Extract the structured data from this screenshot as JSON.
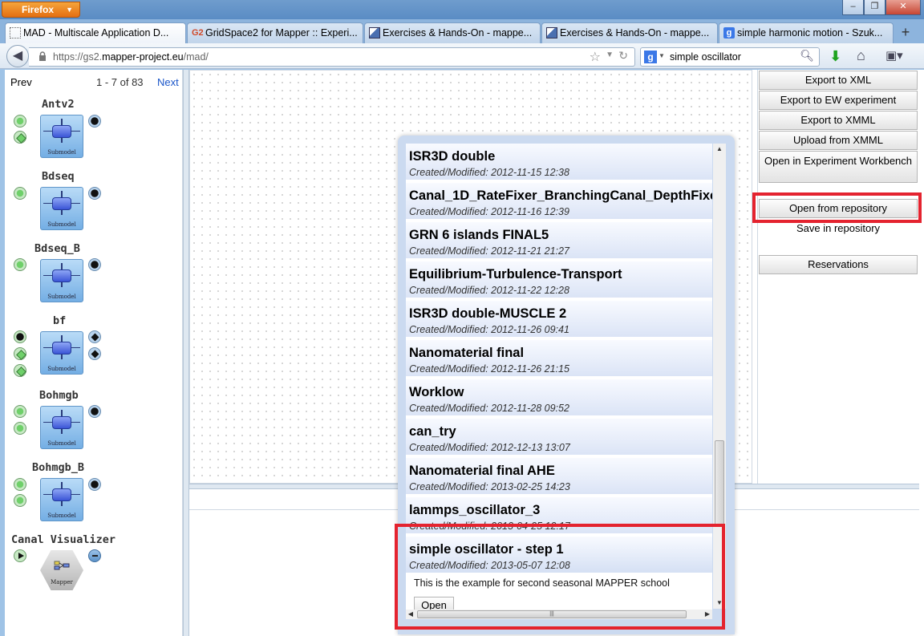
{
  "browser": {
    "menu_label": "Firefox",
    "tabs": [
      {
        "label": "MAD - Multiscale Application D...",
        "icon": "blank-page-icon",
        "active": true
      },
      {
        "label": "GridSpace2 for Mapper :: Experi...",
        "icon": "gridspace-icon",
        "active": false
      },
      {
        "label": "Exercises & Hands-On - mappe...",
        "icon": "page-icon",
        "active": false
      },
      {
        "label": "Exercises & Hands-On - mappe...",
        "icon": "page-icon",
        "active": false
      },
      {
        "label": "simple harmonic motion - Szuk...",
        "icon": "google-icon",
        "active": false
      }
    ],
    "new_tab": "+",
    "url_prefix": "https://gs2.",
    "url_domain": "mapper-project.eu",
    "url_path": "/mad/",
    "search_engine_icon": "google-icon",
    "search_query": "simple oscillator",
    "window_controls": [
      "–",
      "❐",
      "✕"
    ],
    "colors": {
      "accent_orange": "#e46f12",
      "highlight_red": "#e4232f",
      "link_blue": "#1a56c9"
    }
  },
  "sidebar": {
    "prev_label": "Prev",
    "count_label": "1 - 7 of 83",
    "next_label": "Next",
    "submodels": [
      {
        "name": "Antv2",
        "box_label": "Submodel"
      },
      {
        "name": "Bdseq",
        "box_label": "Submodel"
      },
      {
        "name": "Bdseq_B",
        "box_label": "Submodel"
      },
      {
        "name": "bf",
        "box_label": "Submodel"
      },
      {
        "name": "Bohmgb",
        "box_label": "Submodel"
      },
      {
        "name": "Bohmgb_B",
        "box_label": "Submodel"
      },
      {
        "name": "Canal Visualizer",
        "box_label": "Mapper"
      }
    ]
  },
  "actions": {
    "export_xml": "Export to XML",
    "export_ew": "Export to EW experiment",
    "export_xmml": "Export to XMML",
    "upload_xmml": "Upload from XMML",
    "open_workbench": "Open in Experiment Workbench",
    "open_repo": "Open from repository",
    "save_repo": "Save in repository",
    "reservations": "Reservations"
  },
  "repository": {
    "items": [
      {
        "title": "ISR3D double",
        "modified": "Created/Modified: 2012-11-15 12:38"
      },
      {
        "title": "Canal_1D_RateFixer_BranchingCanal_DepthFixe",
        "modified": "Created/Modified: 2012-11-16 12:39"
      },
      {
        "title": "GRN 6 islands FINAL5",
        "modified": "Created/Modified: 2012-11-21 21:27"
      },
      {
        "title": "Equilibrium-Turbulence-Transport",
        "modified": "Created/Modified: 2012-11-22 12:28"
      },
      {
        "title": "ISR3D double-MUSCLE 2",
        "modified": "Created/Modified: 2012-11-26 09:41"
      },
      {
        "title": "Nanomaterial final",
        "modified": "Created/Modified: 2012-11-26 21:15"
      },
      {
        "title": "Worklow",
        "modified": "Created/Modified: 2012-11-28 09:52"
      },
      {
        "title": "can_try",
        "modified": "Created/Modified: 2012-12-13 13:07"
      },
      {
        "title": "Nanomaterial final AHE",
        "modified": "Created/Modified: 2013-02-25 14:23"
      },
      {
        "title": "lammps_oscillator_3",
        "modified": "Created/Modified: 2013-04-25 12:17"
      },
      {
        "title": "simple oscillator - step 1",
        "modified": "Created/Modified: 2013-05-07 12:08"
      }
    ],
    "selected_description": "This is the example for second seasonal MAPPER school",
    "open_label": "Open"
  }
}
